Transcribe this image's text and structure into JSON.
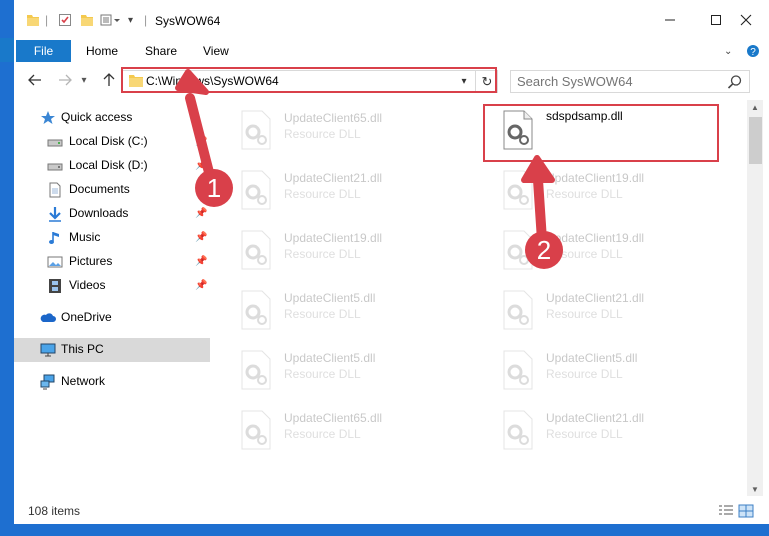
{
  "window": {
    "title": "SysWOW64",
    "controls": [
      "minimize",
      "maximize",
      "close"
    ]
  },
  "ribbon": {
    "tabs": [
      "File",
      "Home",
      "Share",
      "View"
    ]
  },
  "address_bar": {
    "path": "C:\\Windows\\SysWOW64"
  },
  "search": {
    "placeholder": "Search SysWOW64"
  },
  "sidebar": {
    "items": [
      {
        "label": "Quick access",
        "icon": "star-icon"
      },
      {
        "label": "Local Disk (C:)",
        "icon": "drive-icon"
      },
      {
        "label": "Local Disk (D:)",
        "icon": "drive-icon"
      },
      {
        "label": "Documents",
        "icon": "documents-icon"
      },
      {
        "label": "Downloads",
        "icon": "download-arrow-icon"
      },
      {
        "label": "Music",
        "icon": "music-note-icon"
      },
      {
        "label": "Pictures",
        "icon": "pictures-icon"
      },
      {
        "label": "Videos",
        "icon": "film-icon"
      },
      {
        "label": "OneDrive",
        "icon": "cloud-icon"
      },
      {
        "label": "This PC",
        "icon": "monitor-icon"
      },
      {
        "label": "Network",
        "icon": "network-icon"
      }
    ]
  },
  "files": {
    "col1": [
      {
        "name": "UpdateClient65.dll",
        "type": "Resource DLL"
      },
      {
        "name": "UpdateClient21.dll",
        "type": "Resource DLL"
      },
      {
        "name": "UpdateClient19.dll",
        "type": "Resource DLL"
      },
      {
        "name": "UpdateClient5.dll",
        "type": "Resource DLL"
      },
      {
        "name": "UpdateClient5.dll",
        "type": "Resource DLL"
      },
      {
        "name": "UpdateClient65.dll",
        "type": "Resource DLL"
      }
    ],
    "col2": [
      {
        "name": "sdspdsamp.dll",
        "type": ""
      },
      {
        "name": "UpdateClient19.dll",
        "type": "Resource DLL"
      },
      {
        "name": "UpdateClient19.dll",
        "type": "Resource DLL"
      },
      {
        "name": "UpdateClient21.dll",
        "type": "Resource DLL"
      },
      {
        "name": "UpdateClient5.dll",
        "type": "Resource DLL"
      },
      {
        "name": "UpdateClient21.dll",
        "type": "Resource DLL"
      }
    ]
  },
  "status": {
    "item_count": "108 items"
  },
  "annotations": {
    "step1": "1",
    "step2": "2",
    "color": "#d9404a"
  },
  "colors": {
    "accent": "#1979ca",
    "selection": "#d9d9d9"
  }
}
